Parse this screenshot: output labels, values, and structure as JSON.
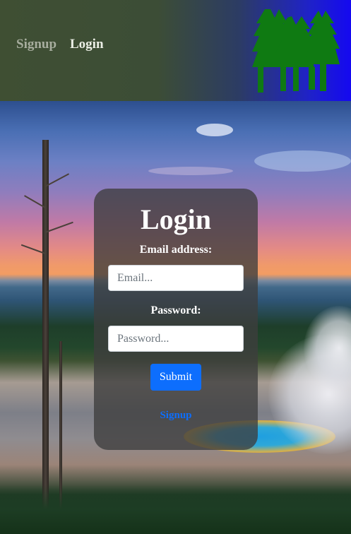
{
  "nav": {
    "signup_label": "Signup",
    "login_label": "Login",
    "logo_icon": "pine-trees-logo-icon"
  },
  "login_form": {
    "title": "Login",
    "email_label": "Email address:",
    "email_placeholder": "Email...",
    "email_value": "",
    "password_label": "Password:",
    "password_placeholder": "Password...",
    "password_value": "",
    "submit_label": "Submit",
    "signup_link": "Signup"
  },
  "colors": {
    "submit_button": "#0d6efd",
    "link": "#0d6efd",
    "logo_green": "#0f7a12",
    "navbar_left": "#3f4f33",
    "navbar_right": "#1509f0"
  }
}
